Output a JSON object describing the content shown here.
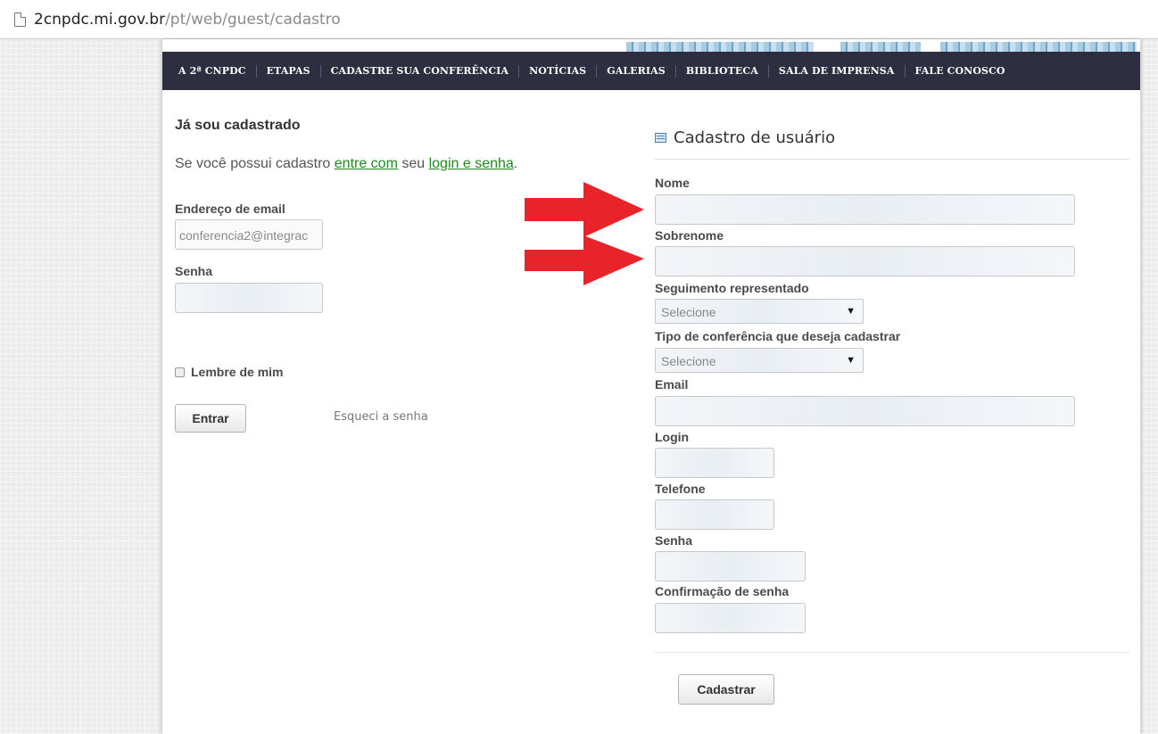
{
  "browser": {
    "url_host": "2cnpdc.mi.gov.br",
    "url_path": "/pt/web/guest/cadastro"
  },
  "nav": {
    "items": [
      "A 2ª CNPDC",
      "ETAPAS",
      "CADASTRE SUA CONFERÊNCIA",
      "NOTÍCIAS",
      "GALERIAS",
      "BIBLIOTECA",
      "SALA DE IMPRENSA",
      "FALE CONOSCO"
    ]
  },
  "login": {
    "title": "Já sou cadastrado",
    "info_before": "Se você possui cadastro ",
    "info_link1": "entre com",
    "info_middle": " seu ",
    "info_link2": "login e senha",
    "info_after": ".",
    "email_label": "Endereço de email",
    "email_value": "conferencia2@integrac",
    "password_label": "Senha",
    "remember_label": "Lembre de mim",
    "submit_label": "Entrar",
    "forgot_label": "Esqueci a senha"
  },
  "register": {
    "title": "Cadastro de usuário",
    "nome_label": "Nome",
    "sobrenome_label": "Sobrenome",
    "seguimento_label": "Seguimento representado",
    "seguimento_value": "Selecione",
    "tipo_label": "Tipo de conferência que deseja cadastrar",
    "tipo_value": "Selecione",
    "email_label": "Email",
    "login_label": "Login",
    "telefone_label": "Telefone",
    "senha_label": "Senha",
    "confirmacao_label": "Confirmação de senha",
    "submit_label": "Cadastrar"
  },
  "colors": {
    "navbar": "#2d2f40",
    "link": "#1d8a1d",
    "annotation_arrow": "#e8232a"
  },
  "icons": {
    "page": "page-icon",
    "form": "form-icon",
    "dropdown": "dropdown-arrow-icon"
  }
}
